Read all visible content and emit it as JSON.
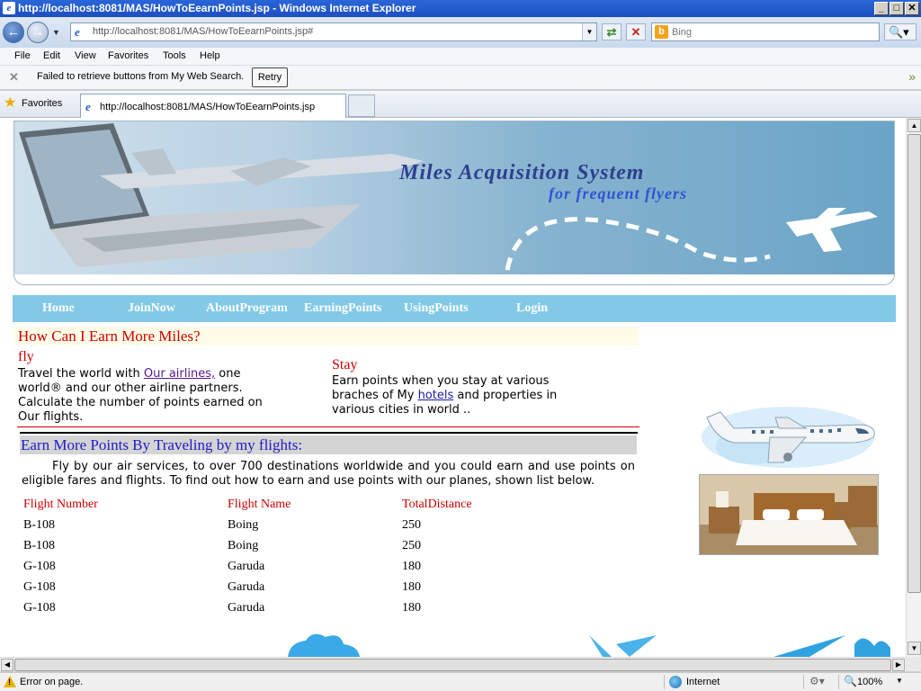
{
  "window": {
    "title": "http://localhost:8081/MAS/HowToEearnPoints.jsp - Windows Internet Explorer",
    "minimize": "_",
    "maximize": "□",
    "close": "✕"
  },
  "address": {
    "url": "http://localhost:8081/MAS/HowToEearnPoints.jsp#",
    "search_placeholder": "Bing"
  },
  "menu": [
    "File",
    "Edit",
    "View",
    "Favorites",
    "Tools",
    "Help"
  ],
  "notification": {
    "message": "Failed to retrieve buttons from My Web Search.",
    "retry": "Retry"
  },
  "favorites_bar": {
    "label": "Favorites",
    "tab_title": "http://localhost:8081/MAS/HowToEearnPoints.jsp"
  },
  "banner": {
    "title": "Miles Acquisition System",
    "subtitle": "for frequent flyers"
  },
  "nav": [
    "Home",
    "JoinNow",
    "AboutProgram",
    "EarningPoints",
    "UsingPoints",
    "Login"
  ],
  "content": {
    "question": "How Can I Earn More Miles?",
    "fly_heading": "fly",
    "fly_text_1": "Travel the world with ",
    "fly_link": "Our airlines,",
    "fly_text_2": " one world® and our other airline partners. Calculate the number of points earned on Our flights.",
    "stay_heading": "Stay",
    "stay_text_1": "Earn points when you stay at various braches of My ",
    "stay_link": "hotels",
    "stay_text_2": " and properties in various cities in world ..",
    "earn_heading": "Earn More Points By Traveling by my flights:",
    "earn_para": "Fly by our air services, to over 700 destinations worldwide and you could earn and use points on eligible fares and flights. To find out how to earn and use points with our planes, shown list below."
  },
  "table": {
    "headers": [
      "Flight Number",
      "Flight Name",
      "TotalDistance"
    ],
    "rows": [
      [
        "B-108",
        "Boing",
        "250"
      ],
      [
        "B-108",
        "Boing",
        "250"
      ],
      [
        "G-108",
        "Garuda",
        "180"
      ],
      [
        "G-108",
        "Garuda",
        "180"
      ],
      [
        "G-108",
        "Garuda",
        "180"
      ]
    ]
  },
  "status": {
    "error": "Error on page.",
    "zone": "Internet",
    "zoom": "100%"
  },
  "colors": {
    "accent_red": "#cc0000",
    "nav_bg": "#82c9e8",
    "heading_blue": "#1c1cc6"
  }
}
